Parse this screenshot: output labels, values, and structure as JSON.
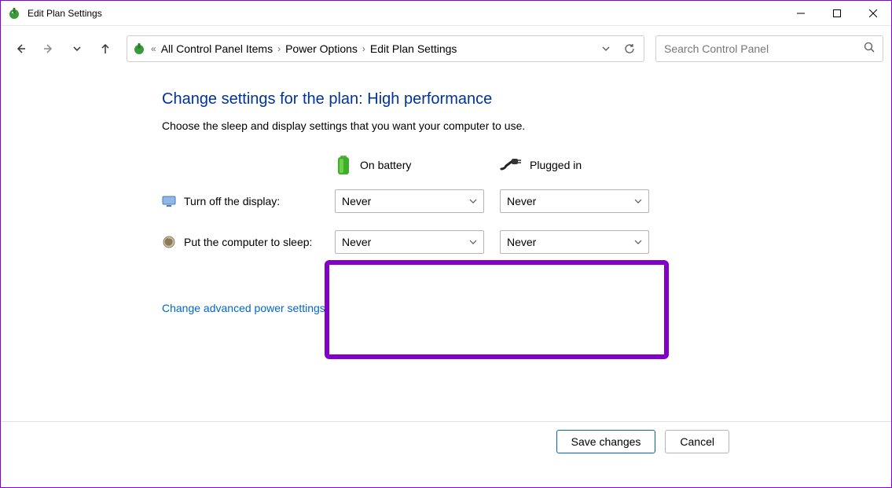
{
  "window": {
    "title": "Edit Plan Settings"
  },
  "breadcrumb": {
    "back_chevrons": "«",
    "items": [
      "All Control Panel Items",
      "Power Options",
      "Edit Plan Settings"
    ]
  },
  "search": {
    "placeholder": "Search Control Panel"
  },
  "page": {
    "heading": "Change settings for the plan: High performance",
    "subheading": "Choose the sleep and display settings that you want your computer to use.",
    "columns": {
      "battery": "On battery",
      "plugged": "Plugged in"
    },
    "rows": {
      "display": {
        "label": "Turn off the display:",
        "battery_value": "Never",
        "plugged_value": "Never"
      },
      "sleep": {
        "label": "Put the computer to sleep:",
        "battery_value": "Never",
        "plugged_value": "Never"
      }
    },
    "advanced_link": "Change advanced power settings"
  },
  "footer": {
    "save": "Save changes",
    "cancel": "Cancel"
  }
}
